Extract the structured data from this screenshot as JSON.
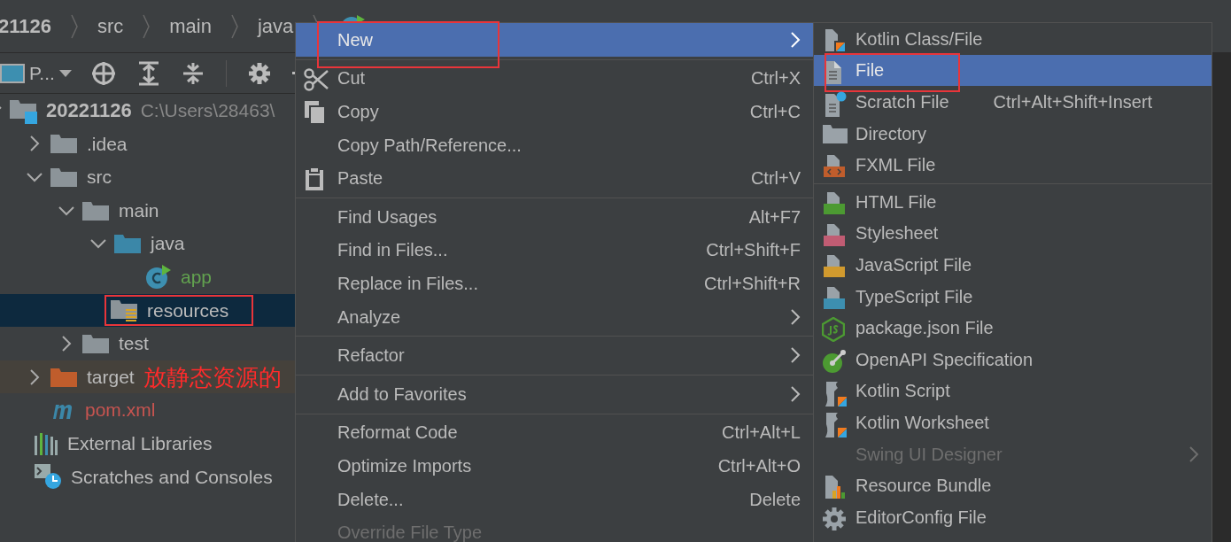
{
  "breadcrumb": [
    {
      "label": "21126"
    },
    {
      "label": "src"
    },
    {
      "label": "main"
    },
    {
      "label": "java"
    }
  ],
  "project_toolbar": {
    "view_label": "P..."
  },
  "tree": [
    {
      "label": "20221126",
      "path": "C:\\Users\\28463\\",
      "kind": "project",
      "expanded": true,
      "selected": false,
      "children": [
        {
          "label": ".idea",
          "kind": "folder",
          "expanded": false,
          "selected": false
        },
        {
          "label": "src",
          "kind": "folder",
          "expanded": true,
          "selected": false,
          "children": [
            {
              "label": "main",
              "kind": "folder",
              "expanded": true,
              "selected": false,
              "children": [
                {
                  "label": "java",
                  "kind": "source-folder",
                  "expanded": true,
                  "selected": false,
                  "children": [
                    {
                      "label": "app",
                      "kind": "class",
                      "selected": false,
                      "color": "#62a24f"
                    }
                  ]
                },
                {
                  "label": "resources",
                  "kind": "resources-folder",
                  "selected": true,
                  "framed": true
                }
              ]
            },
            {
              "label": "test",
              "kind": "folder",
              "expanded": false,
              "selected": false
            }
          ]
        },
        {
          "label": "target",
          "kind": "excluded-folder",
          "expanded": false,
          "selected": false,
          "note": "放静态资源的"
        },
        {
          "label": "pom.xml",
          "kind": "maven",
          "selected": false,
          "color": "#c75450"
        }
      ]
    },
    {
      "label": "External Libraries",
      "kind": "libraries",
      "selected": false
    },
    {
      "label": "Scratches and Consoles",
      "kind": "scratches",
      "selected": false
    }
  ],
  "context_menu": [
    {
      "kind": "item",
      "label": "New",
      "submenu": true,
      "selected": true,
      "framed": true
    },
    {
      "kind": "separator"
    },
    {
      "kind": "item",
      "label": "Cut",
      "shortcut": "Ctrl+X",
      "selected": false
    },
    {
      "kind": "item",
      "label": "Copy",
      "shortcut": "Ctrl+C",
      "selected": false
    },
    {
      "kind": "item",
      "label": "Copy Path/Reference...",
      "selected": false
    },
    {
      "kind": "item",
      "label": "Paste",
      "shortcut": "Ctrl+V",
      "selected": false
    },
    {
      "kind": "separator"
    },
    {
      "kind": "item",
      "label": "Find Usages",
      "shortcut": "Alt+F7",
      "selected": false
    },
    {
      "kind": "item",
      "label": "Find in Files...",
      "shortcut": "Ctrl+Shift+F",
      "selected": false
    },
    {
      "kind": "item",
      "label": "Replace in Files...",
      "shortcut": "Ctrl+Shift+R",
      "selected": false
    },
    {
      "kind": "item",
      "label": "Analyze",
      "submenu": true,
      "selected": false
    },
    {
      "kind": "separator"
    },
    {
      "kind": "item",
      "label": "Refactor",
      "submenu": true,
      "selected": false
    },
    {
      "kind": "separator"
    },
    {
      "kind": "item",
      "label": "Add to Favorites",
      "submenu": true,
      "selected": false
    },
    {
      "kind": "separator"
    },
    {
      "kind": "item",
      "label": "Reformat Code",
      "shortcut": "Ctrl+Alt+L",
      "selected": false
    },
    {
      "kind": "item",
      "label": "Optimize Imports",
      "shortcut": "Ctrl+Alt+O",
      "selected": false
    },
    {
      "kind": "item",
      "label": "Delete...",
      "shortcut": "Delete",
      "selected": false
    },
    {
      "kind": "item",
      "label": "Override File Type",
      "disabled": true,
      "selected": false
    }
  ],
  "new_submenu": [
    {
      "kind": "kotlin",
      "label": "Kotlin Class/File",
      "selected": false
    },
    {
      "kind": "file",
      "label": "File",
      "selected": true,
      "framed": true
    },
    {
      "kind": "scratch",
      "label": "Scratch File",
      "shortcut": "Ctrl+Alt+Shift+Insert",
      "selected": false
    },
    {
      "kind": "directory",
      "label": "Directory",
      "selected": false
    },
    {
      "kind": "fxml",
      "label": "FXML File",
      "selected": false
    },
    {
      "kind": "separator"
    },
    {
      "kind": "html",
      "label": "HTML File",
      "selected": false
    },
    {
      "kind": "css",
      "label": "Stylesheet",
      "selected": false
    },
    {
      "kind": "js",
      "label": "JavaScript File",
      "selected": false
    },
    {
      "kind": "ts",
      "label": "TypeScript File",
      "selected": false
    },
    {
      "kind": "npm",
      "label": "package.json File",
      "selected": false
    },
    {
      "kind": "openapi",
      "label": "OpenAPI Specification",
      "selected": false
    },
    {
      "kind": "kts",
      "label": "Kotlin Script",
      "selected": false
    },
    {
      "kind": "kts",
      "label": "Kotlin Worksheet",
      "selected": false
    },
    {
      "kind": "none",
      "label": "Swing UI Designer",
      "submenu": true,
      "disabled": true,
      "selected": false
    },
    {
      "kind": "bundle",
      "label": "Resource Bundle",
      "selected": false
    },
    {
      "kind": "gear",
      "label": "EditorConfig File",
      "selected": false
    }
  ]
}
